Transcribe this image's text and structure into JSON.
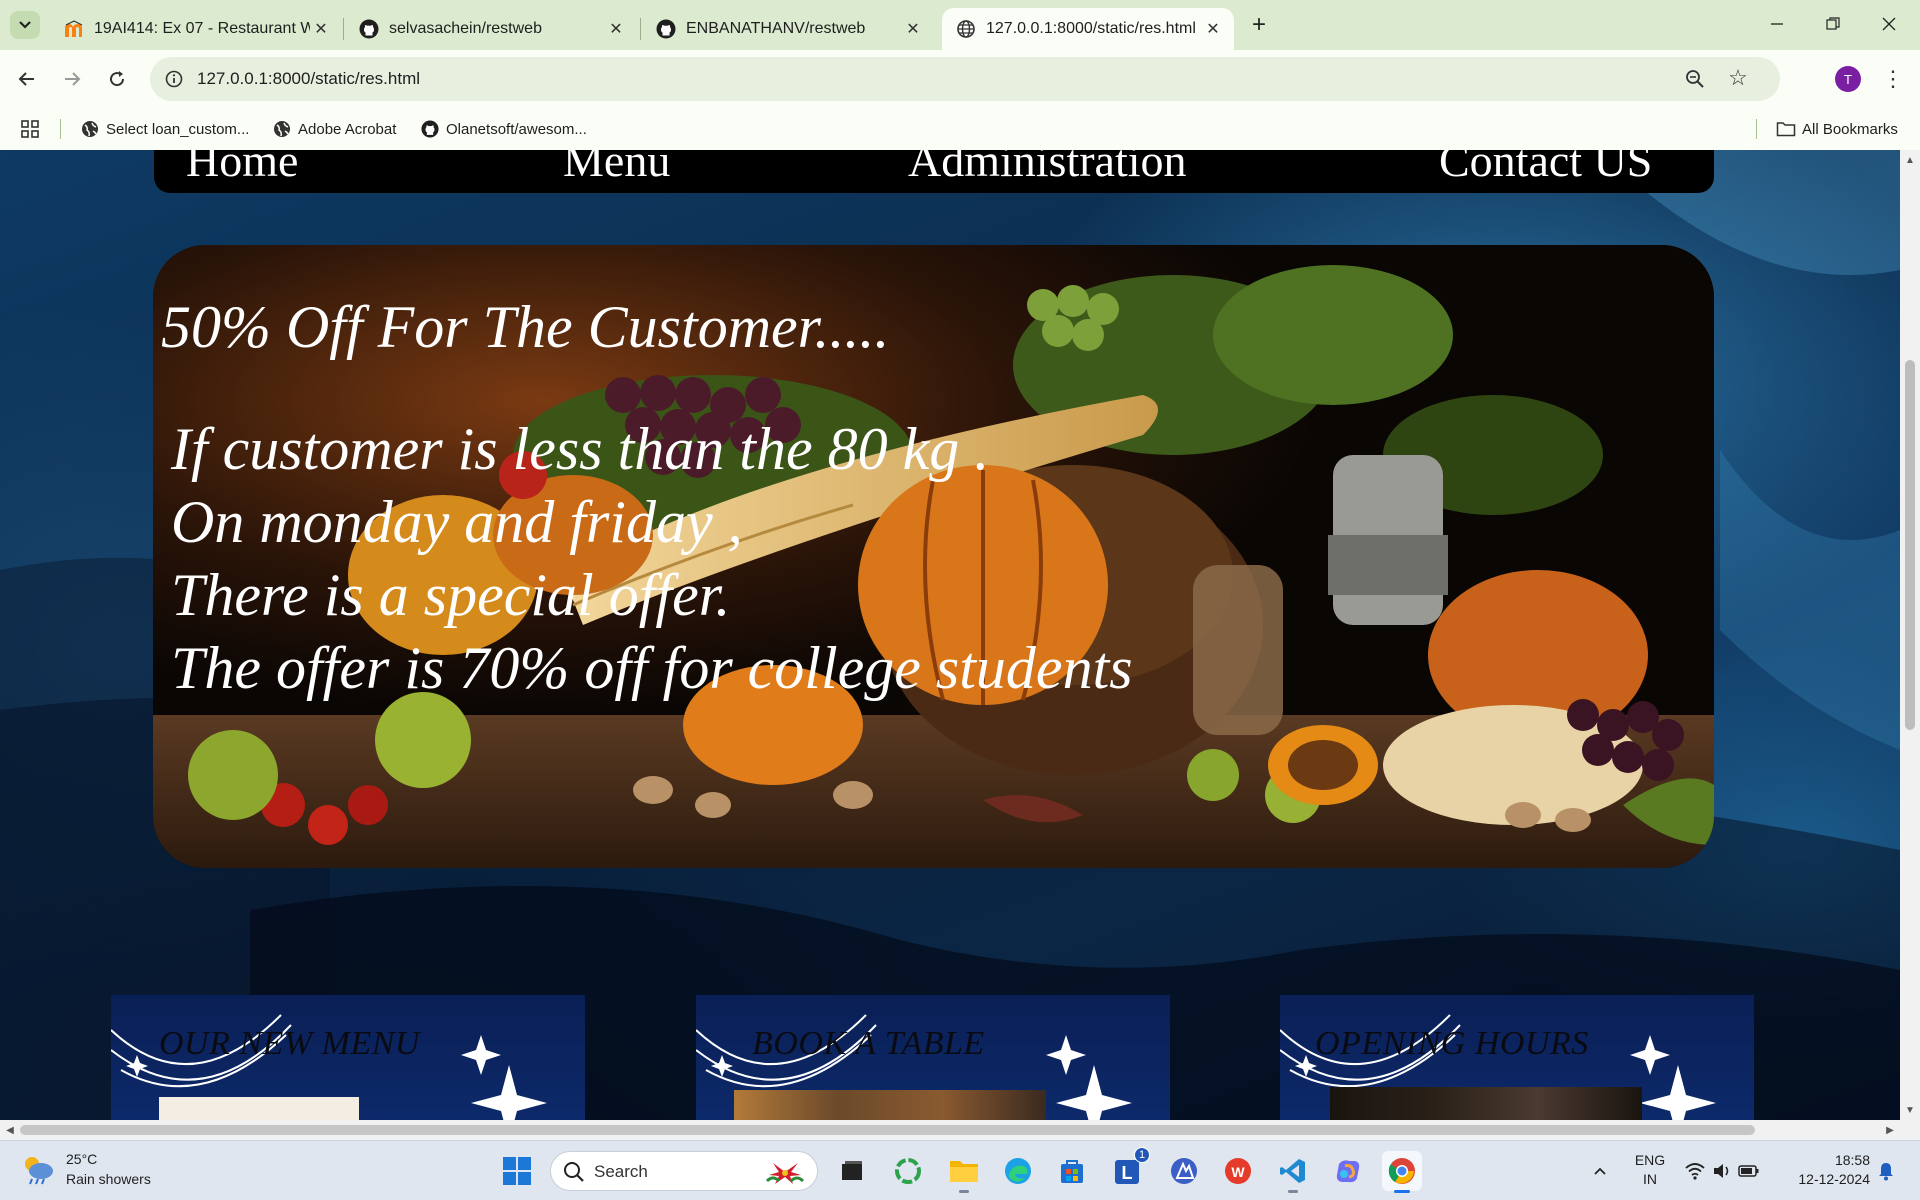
{
  "browser": {
    "tabs": [
      {
        "title": "19AI414: Ex 07 - Restaurant We",
        "favicon": "moodle-icon",
        "active": false
      },
      {
        "title": "selvasachein/restweb",
        "favicon": "github-icon",
        "active": false
      },
      {
        "title": "ENBANATHANV/restweb",
        "favicon": "github-icon",
        "active": false
      },
      {
        "title": "127.0.0.1:8000/static/res.html",
        "favicon": "globe-icon",
        "active": true
      }
    ],
    "url": "127.0.0.1:8000/static/res.html",
    "profile_initial": "T",
    "bookmarks": [
      {
        "label": "Select loan_custom...",
        "icon": "globe-icon"
      },
      {
        "label": "Adobe Acrobat",
        "icon": "globe-icon"
      },
      {
        "label": "Olanetsoft/awesom...",
        "icon": "github-icon"
      }
    ],
    "all_bookmarks_label": "All Bookmarks"
  },
  "page": {
    "nav": [
      "Home",
      "Menu",
      "Administration",
      "Contact US"
    ],
    "hero": {
      "title": "50% Off For The Customer.....",
      "lines": [
        "If customer is less than the 80 kg .",
        "On monday and friday ,",
        "There is a special offer.",
        "The offer is 70% off for college students"
      ]
    },
    "cards": [
      {
        "title": "OUR NEW MENU"
      },
      {
        "title": "BOOK A TABLE"
      },
      {
        "title": "OPENING HOURS"
      }
    ]
  },
  "taskbar": {
    "weather": {
      "temp": "25°C",
      "condition": "Rain showers"
    },
    "search_placeholder": "Search",
    "language": {
      "line1": "ENG",
      "line2": "IN"
    },
    "clock": {
      "time": "18:58",
      "date": "12-12-2024"
    },
    "badge_count": "1"
  }
}
